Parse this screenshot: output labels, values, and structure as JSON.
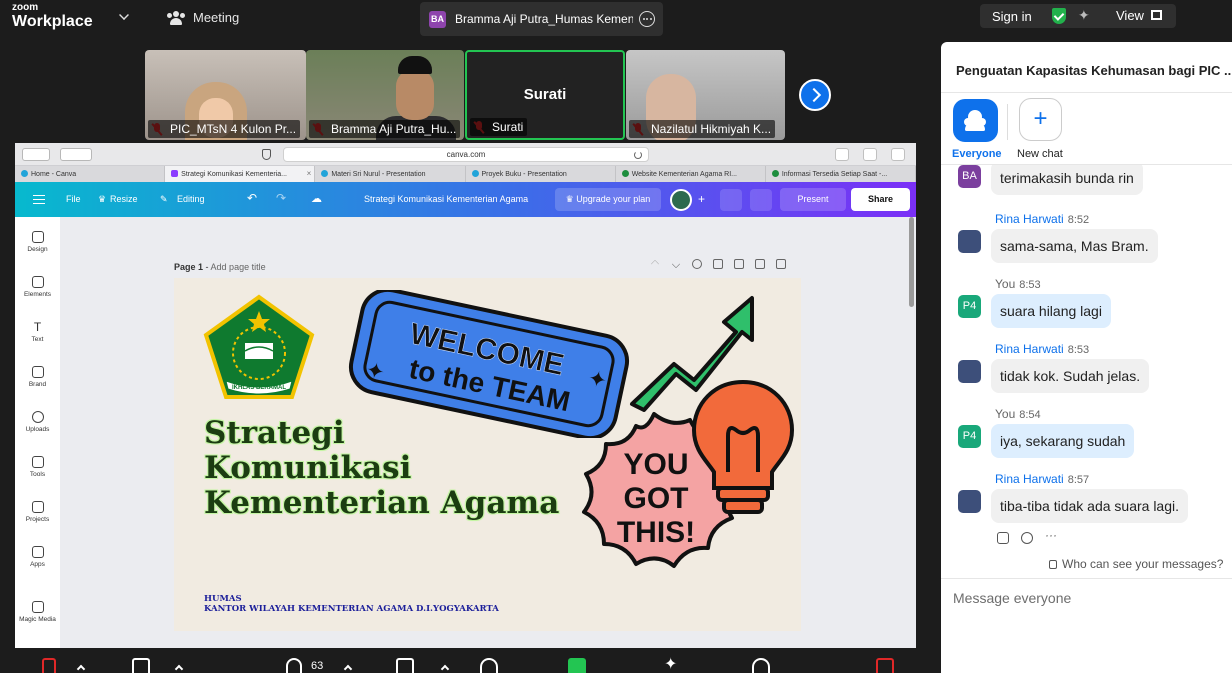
{
  "topbar": {
    "logo_line1": "zoom",
    "logo_line2": "Workplace",
    "meeting_label": "Meeting",
    "active_speaker_initials": "BA",
    "active_speaker": "Bramma Aji Putra_Humas Kemen",
    "sign_in": "Sign in",
    "view": "View"
  },
  "participants": [
    {
      "name": "PIC_MTsN 4 Kulon Pr..."
    },
    {
      "name": "Bramma Aji Putra_Hu..."
    },
    {
      "name": "Surati",
      "big_name": "Surati"
    },
    {
      "name": "Nazilatul Hikmiyah K..."
    }
  ],
  "browser": {
    "url": "canva.com",
    "tabs": [
      {
        "label": "Home - Canva"
      },
      {
        "label": "Strategi Komunikasi Kementeria..."
      },
      {
        "label": "Materi Sri Nurul - Presentation"
      },
      {
        "label": "Proyek Buku - Presentation"
      },
      {
        "label": "Website Kementerian Agama RI..."
      },
      {
        "label": "Informasi Tersedia Setiap Saat -..."
      }
    ]
  },
  "canva": {
    "file": "File",
    "resize": "Resize",
    "editing": "Editing",
    "doc_title": "Strategi Komunikasi Kementerian Agama",
    "upgrade": "Upgrade your plan",
    "present": "Present",
    "share": "Share",
    "rail": [
      "Design",
      "Elements",
      "Text",
      "Brand",
      "Uploads",
      "Tools",
      "Projects",
      "Apps",
      "Magic Media"
    ],
    "page_label": "Page 1",
    "page_sub": "Add page title"
  },
  "slide": {
    "title_lines": [
      "Strategi",
      "Komunikasi",
      "Kementerian Agama"
    ],
    "footer_line1": "HUMAS",
    "footer_line2": "KANTOR WILAYAH KEMENTERIAN AGAMA D.I.YOGYAKARTA",
    "sticker1_line1": "WELCOME",
    "sticker1_line2": "to the TEAM",
    "sticker2_lines": [
      "YOU",
      "GOT",
      "THIS!"
    ],
    "logo_ribbon": "IKHLAS BERAMAL",
    "colors": {
      "title": "#1c3d12",
      "glow": "#c5f5a4",
      "footer": "#1c1f9a",
      "blue": "#3f7fe8",
      "pink": "#f4a3a3",
      "orange": "#f26a3b",
      "green": "#2fbf6b"
    }
  },
  "bottombar": {
    "participants_count": "63"
  },
  "chat": {
    "title": "Penguatan Kapasitas Kehumasan bagi PIC ...",
    "everyone": "Everyone",
    "new_chat": "New chat",
    "messages": [
      {
        "initials": "BA",
        "text": "terimakasih bunda rin"
      },
      {
        "sender": "Rina Harwati",
        "time": "8:52",
        "text": "sama-sama, Mas Bram."
      },
      {
        "sender": "You",
        "initials": "P4",
        "time": "8:53",
        "text": "suara hilang lagi"
      },
      {
        "sender": "Rina Harwati",
        "time": "8:53",
        "text": "tidak kok. Sudah jelas."
      },
      {
        "sender": "You",
        "initials": "P4",
        "time": "8:54",
        "text": "iya, sekarang sudah"
      },
      {
        "sender": "Rina Harwati",
        "time": "8:57",
        "text": "tiba-tiba tidak ada suara lagi."
      }
    ],
    "who_can_see": "Who can see your messages?",
    "input_placeholder": "Message everyone"
  }
}
